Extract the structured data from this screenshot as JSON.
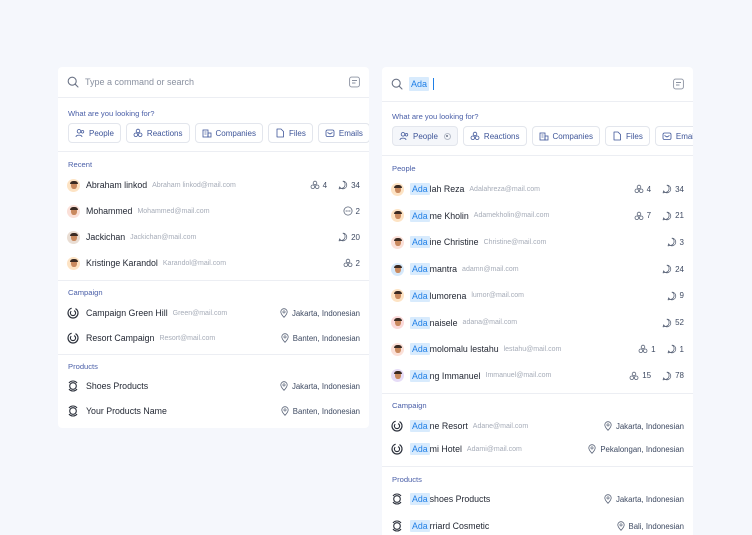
{
  "left": {
    "search_placeholder": "Type a command or search",
    "looking_for": "What are you looking for?",
    "chips": [
      {
        "label": "People",
        "icon": "people-icon"
      },
      {
        "label": "Reactions",
        "icon": "reactions-icon"
      },
      {
        "label": "Companies",
        "icon": "companies-icon"
      },
      {
        "label": "Files",
        "icon": "files-icon"
      },
      {
        "label": "Emails",
        "icon": "emails-icon"
      }
    ],
    "recent_label": "Recent",
    "recent": [
      {
        "name": "Abraham linkod",
        "email": "Abraham linkod@mail.com",
        "reactions": "4",
        "comments": "34",
        "avatar_bg": "#fde3c4"
      },
      {
        "name": "Mohammed",
        "email": "Mohammed@mail.com",
        "more": "2",
        "avatar_bg": "#fbe0d8"
      },
      {
        "name": "Jackichan",
        "email": "Jackichan@mail.com",
        "comments": "20",
        "avatar_bg": "#e9ddd3"
      },
      {
        "name": "Kristinge Karandol",
        "email": "Karandol@mail.com",
        "reactions": "2",
        "avatar_bg": "#fde3c4"
      }
    ],
    "campaign_label": "Campaign",
    "campaigns": [
      {
        "name": "Campaign Green Hill",
        "email": "Green@mail.com",
        "location": "Jakarta, Indonesian"
      },
      {
        "name": "Resort Campaign",
        "email": "Resort@mail.com",
        "location": "Banten, Indonesian"
      }
    ],
    "products_label": "Products",
    "products": [
      {
        "name": "Shoes Products",
        "location": "Jakarta, Indonesian"
      },
      {
        "name": "Your Products Name",
        "location": "Banten, Indonesian"
      }
    ]
  },
  "right": {
    "query": "Ada",
    "looking_for": "What are you looking for?",
    "chips": [
      {
        "label": "People",
        "icon": "people-icon"
      },
      {
        "label": "Reactions",
        "icon": "reactions-icon"
      },
      {
        "label": "Companies",
        "icon": "companies-icon"
      },
      {
        "label": "Files",
        "icon": "files-icon"
      },
      {
        "label": "Emails",
        "icon": "emails-icon"
      }
    ],
    "people_label": "People",
    "people": [
      {
        "match": "Ada",
        "rest": "lah Reza",
        "email": "Adalahreza@mail.com",
        "reactions": "4",
        "comments": "34",
        "avatar_bg": "#fde3c4"
      },
      {
        "match": "Ada",
        "rest": "me Kholin",
        "email": "Adamekholin@mail.com",
        "reactions": "7",
        "comments": "21",
        "avatar_bg": "#fde3c4"
      },
      {
        "match": "Ada",
        "rest": "ine Christine",
        "email": "Christine@mail.com",
        "comments": "3",
        "avatar_bg": "#fbe0d8"
      },
      {
        "match": "Ada",
        "rest": "mantra",
        "email": "adamn@mail.com",
        "comments": "24",
        "avatar_bg": "#d6e9fb"
      },
      {
        "match": "Ada",
        "rest": "lumorena",
        "email": "lumor@mail.com",
        "comments": "9",
        "avatar_bg": "#fde3c4"
      },
      {
        "match": "Ada",
        "rest": "naisele",
        "email": "adana@mail.com",
        "comments": "52",
        "avatar_bg": "#fbd9d9"
      },
      {
        "match": "Ada",
        "rest": "molomalu lestahu",
        "email": "lestahu@mail.com",
        "reactions": "1",
        "comments": "1",
        "avatar_bg": "#fbe0d8"
      },
      {
        "match": "Ada",
        "rest": "ng Immanuel",
        "email": "Immanuel@mail.com",
        "reactions": "15",
        "comments": "78",
        "avatar_bg": "#e6dcf7"
      }
    ],
    "campaign_label": "Campaign",
    "campaigns": [
      {
        "match": "Ada",
        "rest": "ne Resort",
        "email": "Adane@mail.com",
        "location": "Jakarta, Indonesian"
      },
      {
        "match": "Ada",
        "rest": "mi Hotel",
        "email": "Adami@mail.com",
        "location": "Pekalongan, Indonesian"
      }
    ],
    "products_label": "Products",
    "products": [
      {
        "match": "Ada",
        "rest": "shoes Products",
        "location": "Jakarta, Indonesian"
      },
      {
        "match": "Ada",
        "rest": "rriard Cosmetic",
        "location": "Bali, Indonesian"
      }
    ]
  }
}
